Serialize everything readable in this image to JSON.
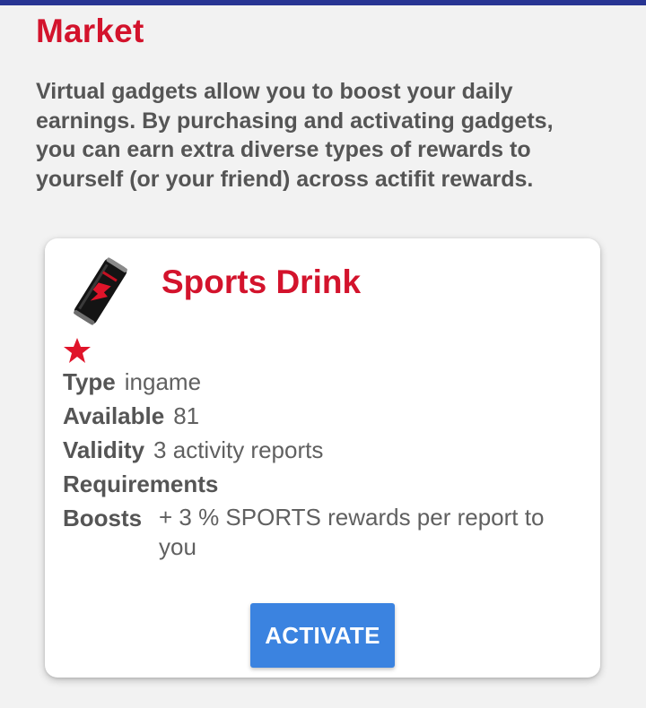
{
  "colors": {
    "accent_red": "#d3132c",
    "button_blue": "#3b83e0",
    "top_bar": "#283593"
  },
  "page": {
    "title": "Market",
    "intro_lines": [
      "Virtual gadgets allow you to boost your daily",
      "earnings. By purchasing and activating gadgets,",
      "you can earn extra diverse types of rewards to",
      "yourself (or your friend) across actifit rewards."
    ]
  },
  "gadget": {
    "icon": "energy-drink-can-icon",
    "name": "Sports Drink",
    "star_icon": "star-icon",
    "type_label": "Type",
    "type_value": "ingame",
    "available_label": "Available",
    "available_value": "81",
    "validity_label": "Validity",
    "validity_value": "3 activity reports",
    "requirements_label": "Requirements",
    "boosts_label": "Boosts",
    "boosts_line1": "+ 3 % SPORTS rewards per report to",
    "boosts_line2": "you",
    "activate_label": "ACTIVATE"
  }
}
